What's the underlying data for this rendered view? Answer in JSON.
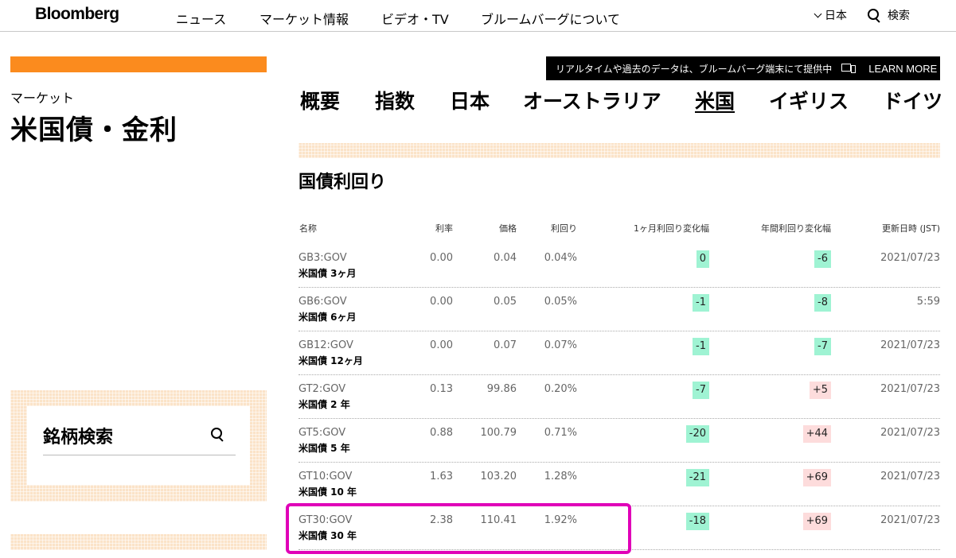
{
  "header": {
    "logo": "Bloomberg",
    "nav": [
      "ニュース",
      "マーケット情報",
      "ビデオ・TV",
      "ブルームバーグについて"
    ],
    "region": "日本",
    "search_label": "検索"
  },
  "sidebar": {
    "breadcrumb": "マーケット",
    "title": "米国債・金利",
    "search_title": "銘柄検索"
  },
  "promo": {
    "text": "リアルタイムや過去のデータは、ブルームバーグ端末にて提供中",
    "link": "LEARN MORE"
  },
  "tabs": [
    "概要",
    "指数",
    "日本",
    "オーストラリア",
    "米国",
    "イギリス",
    "ドイツ"
  ],
  "active_tab": "米国",
  "section_title": "国債利回り",
  "table": {
    "headers": [
      "名称",
      "利率",
      "価格",
      "利回り",
      "1ヶ月利回り変化幅",
      "年間利回り変化幅",
      "更新日時 (JST)"
    ],
    "rows": [
      {
        "ticker": "GB3:GOV",
        "name": "米国債 3ヶ月",
        "coupon": "0.00",
        "price": "0.04",
        "yield": "0.04%",
        "m1": "0",
        "yr": "-6",
        "updated": "2021/07/23"
      },
      {
        "ticker": "GB6:GOV",
        "name": "米国債 6ヶ月",
        "coupon": "0.00",
        "price": "0.05",
        "yield": "0.05%",
        "m1": "-1",
        "yr": "-8",
        "updated": "5:59"
      },
      {
        "ticker": "GB12:GOV",
        "name": "米国債 12ヶ月",
        "coupon": "0.00",
        "price": "0.07",
        "yield": "0.07%",
        "m1": "-1",
        "yr": "-7",
        "updated": "2021/07/23"
      },
      {
        "ticker": "GT2:GOV",
        "name": "米国債 2 年",
        "coupon": "0.13",
        "price": "99.86",
        "yield": "0.20%",
        "m1": "-7",
        "yr": "+5",
        "updated": "2021/07/23"
      },
      {
        "ticker": "GT5:GOV",
        "name": "米国債 5 年",
        "coupon": "0.88",
        "price": "100.79",
        "yield": "0.71%",
        "m1": "-20",
        "yr": "+44",
        "updated": "2021/07/23"
      },
      {
        "ticker": "GT10:GOV",
        "name": "米国債 10 年",
        "coupon": "1.63",
        "price": "103.20",
        "yield": "1.28%",
        "m1": "-21",
        "yr": "+69",
        "updated": "2021/07/23"
      },
      {
        "ticker": "GT30:GOV",
        "name": "米国債 30 年",
        "coupon": "2.38",
        "price": "110.41",
        "yield": "1.92%",
        "m1": "-18",
        "yr": "+69",
        "updated": "2021/07/23"
      }
    ]
  },
  "colors": {
    "accent_orange": "#fb8b1e",
    "negative_badge": "#9ff3d3",
    "positive_badge": "#fddcdc",
    "highlight": "#e000b8"
  }
}
